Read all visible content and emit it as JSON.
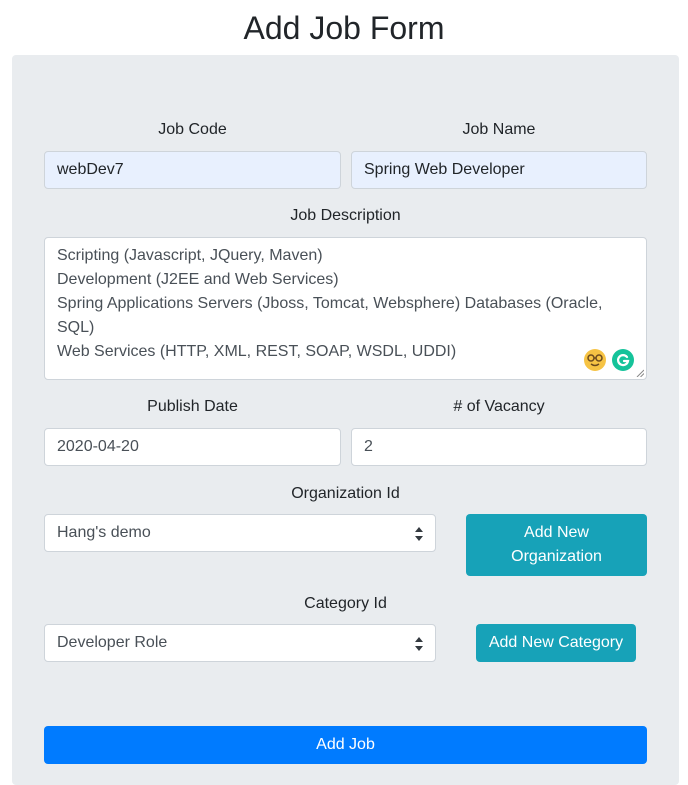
{
  "page": {
    "title": "Add Job Form"
  },
  "form": {
    "job_code": {
      "label": "Job Code",
      "value": "webDev7"
    },
    "job_name": {
      "label": "Job Name",
      "value": "Spring Web Developer"
    },
    "job_description": {
      "label": "Job Description",
      "lines": [
        "Scripting (Javascript, JQuery, Maven)",
        "Development (J2EE and Web Services)",
        "Spring Applications Servers (Jboss, Tomcat, Websphere) Databases (Oracle, SQL)",
        "Web Services (HTTP, XML, REST, SOAP, WSDL, UDDI)"
      ]
    },
    "publish_date": {
      "label": "Publish Date",
      "value": "2020-04-20"
    },
    "vacancy": {
      "label": "# of Vacancy",
      "value": "2"
    },
    "organization": {
      "label": "Organization Id",
      "selected": "Hang's demo",
      "add_button_line1": "Add New",
      "add_button_line2": "Organization"
    },
    "category": {
      "label": "Category Id",
      "selected": "Developer Role",
      "add_button": "Add New Category"
    },
    "submit_label": "Add Job"
  },
  "colors": {
    "card_bg": "#e9ecef",
    "info_button": "#17a2b8",
    "primary_button": "#007bff",
    "autofill_bg": "#e8f0fe"
  }
}
